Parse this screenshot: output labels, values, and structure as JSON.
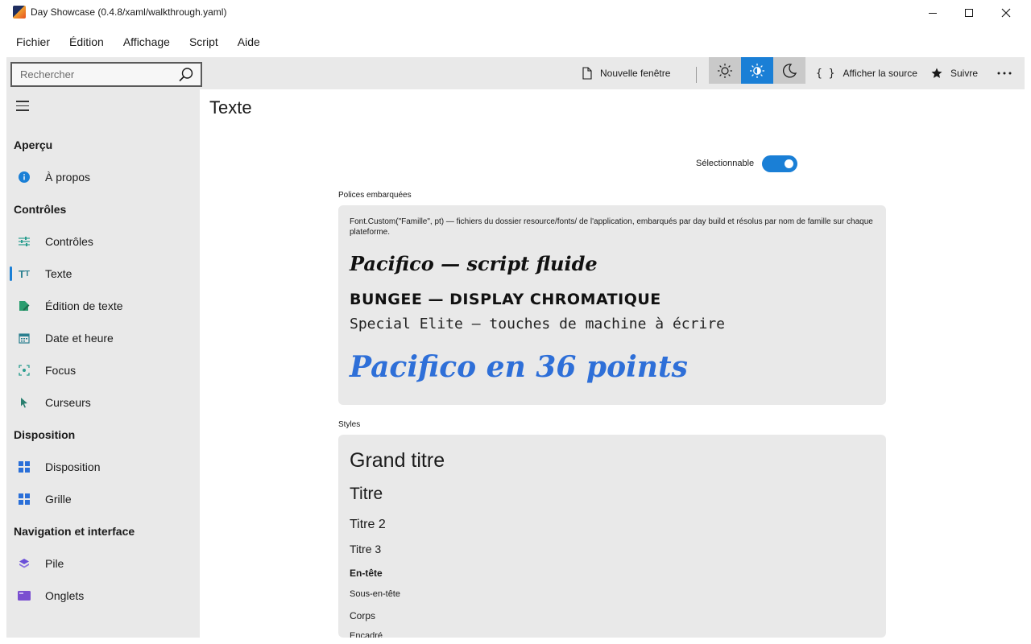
{
  "window": {
    "title": "Day Showcase (0.4.8/xaml/walkthrough.yaml)"
  },
  "menu": [
    "Fichier",
    "Édition",
    "Affichage",
    "Script",
    "Aide"
  ],
  "toolbar": {
    "search_placeholder": "Rechercher",
    "new_window": "Nouvelle fenêtre",
    "theme_modes": [
      "light-icon",
      "auto-icon",
      "dark-icon"
    ],
    "theme_selected": "auto",
    "view_source": "Afficher la source",
    "follow": "Suivre"
  },
  "sidebar": {
    "sections": [
      {
        "title": "Aperçu",
        "items": [
          {
            "label": "À propos",
            "icon": "info-icon"
          }
        ]
      },
      {
        "title": "Contrôles",
        "items": [
          {
            "label": "Contrôles",
            "icon": "sliders-icon"
          },
          {
            "label": "Texte",
            "icon": "text-icon",
            "active": true
          },
          {
            "label": "Édition de texte",
            "icon": "edit-document-icon"
          },
          {
            "label": "Date et heure",
            "icon": "calendar-icon"
          },
          {
            "label": "Focus",
            "icon": "focus-icon"
          },
          {
            "label": "Curseurs",
            "icon": "cursor-icon"
          }
        ]
      },
      {
        "title": "Disposition",
        "items": [
          {
            "label": "Disposition",
            "icon": "layout-icon"
          },
          {
            "label": "Grille",
            "icon": "grid-icon"
          }
        ]
      },
      {
        "title": "Navigation et interface",
        "items": [
          {
            "label": "Pile",
            "icon": "stack-icon"
          },
          {
            "label": "Onglets",
            "icon": "tabs-icon"
          }
        ]
      }
    ]
  },
  "main": {
    "title": "Texte",
    "selectable_label": "Sélectionnable",
    "selectable_on": true,
    "fonts_caption": "Polices embarquées",
    "fonts_desc": "Font.Custom(\"Famille\", pt) — fichiers du dossier resource/fonts/ de l'application, embarqués par day build et résolus par nom de famille sur chaque plateforme.",
    "font_samples": {
      "pacifico": "Pacifico — script fluide",
      "bungee": "BUNGEE — DISPLAY CHROMATIQUE",
      "special": "Special Elite — touches de machine à écrire",
      "pacifico_big": "Pacifico en 36 points"
    },
    "styles_caption": "Styles",
    "styles": {
      "grand_titre": "Grand titre",
      "titre": "Titre",
      "titre2": "Titre 2",
      "titre3": "Titre 3",
      "entete": "En-tête",
      "sous_entete": "Sous-en-tête",
      "corps": "Corps",
      "encadre": "Encadré"
    }
  },
  "colors": {
    "accent": "#1a7fd6",
    "sidebar_bg": "#e9e9e9",
    "pacifico_big": "#2e6fd8"
  }
}
